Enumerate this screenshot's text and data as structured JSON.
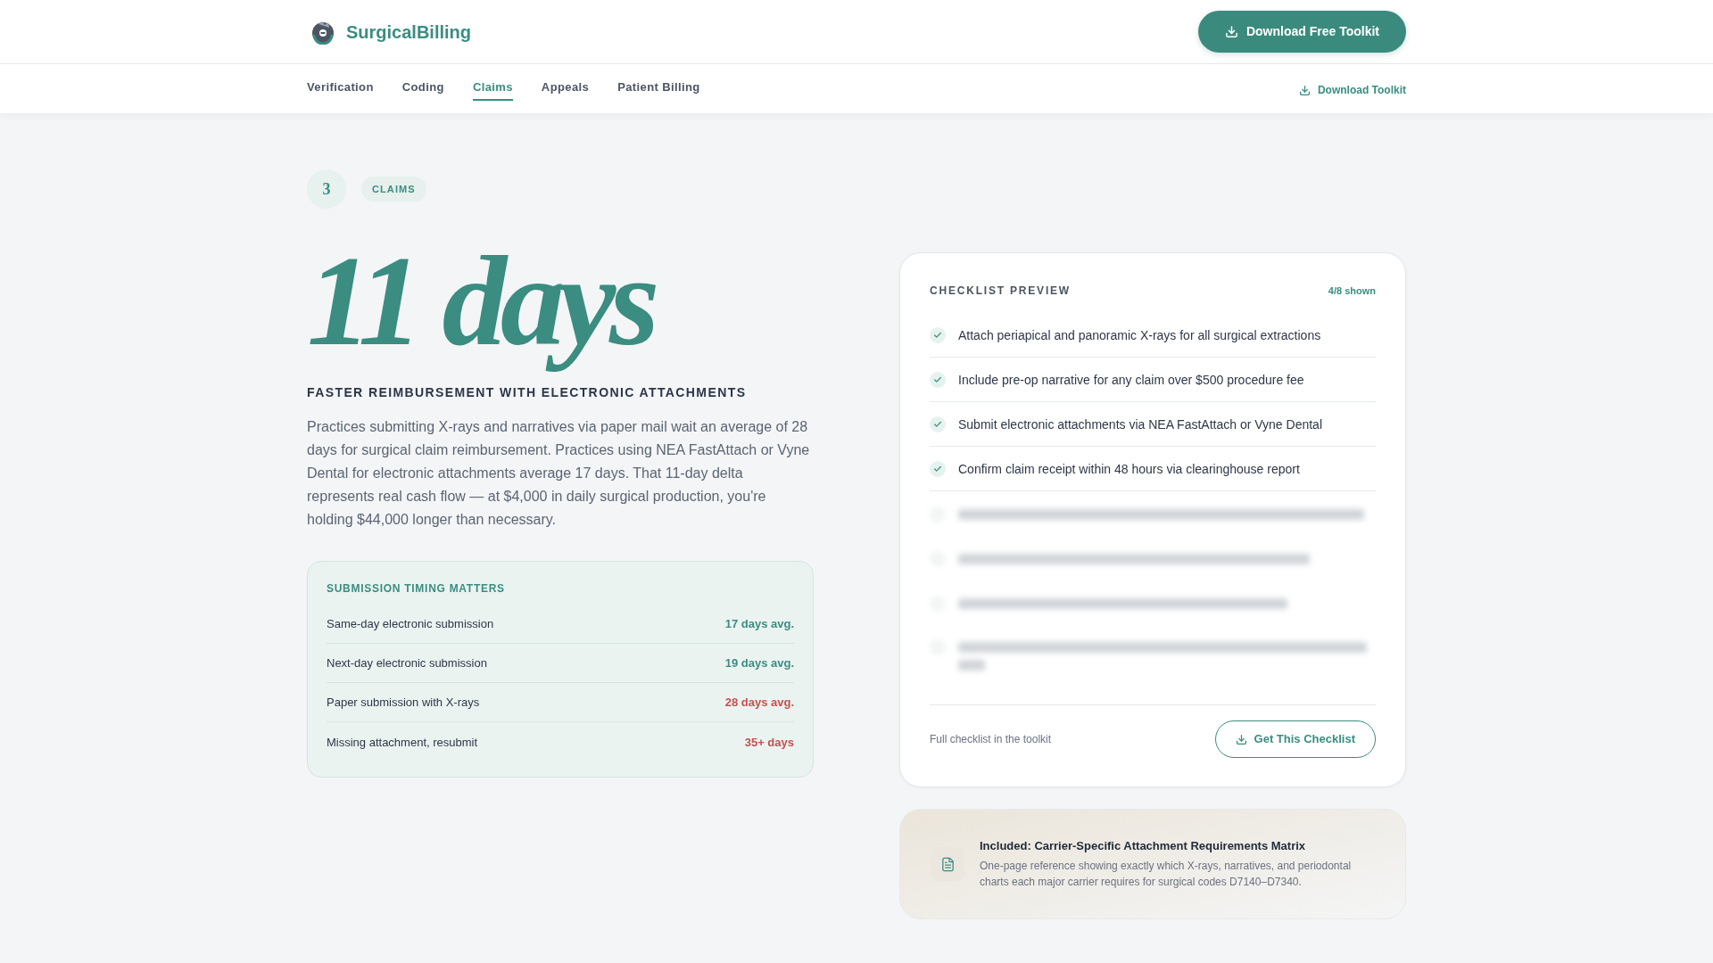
{
  "header": {
    "brand": "SurgicalBilling",
    "cta": "Download Free Toolkit"
  },
  "nav": {
    "items": [
      {
        "label": "Verification",
        "selected": false
      },
      {
        "label": "Coding",
        "selected": false
      },
      {
        "label": "Claims",
        "selected": true
      },
      {
        "label": "Appeals",
        "selected": false
      },
      {
        "label": "Patient Billing",
        "selected": false
      }
    ],
    "download": "Download Toolkit"
  },
  "section": {
    "number": "3",
    "tag": "CLAIMS"
  },
  "hero": {
    "stat": "11 days",
    "subtitle": "FASTER REIMBURSEMENT WITH ELECTRONIC ATTACHMENTS",
    "body": "Practices submitting X-rays and narratives via paper mail wait an average of 28 days for surgical claim reimbursement. Practices using NEA FastAttach or Vyne Dental for electronic attachments average 17 days. That 11-day delta represents real cash flow — at $4,000 in daily surgical production, you're holding $44,000 longer than necessary."
  },
  "timing_table": {
    "title": "SUBMISSION TIMING MATTERS",
    "rows": [
      {
        "label": "Same-day electronic submission",
        "value": "17 days avg.",
        "color": "#3a8d80"
      },
      {
        "label": "Next-day electronic submission",
        "value": "19 days avg.",
        "color": "#3a8d80"
      },
      {
        "label": "Paper submission with X-rays",
        "value": "28 days avg.",
        "color": "#c94f4f"
      },
      {
        "label": "Missing attachment, resubmit",
        "value": "35+ days",
        "color": "#c94f4f"
      }
    ]
  },
  "checklist": {
    "title": "CHECKLIST PREVIEW",
    "count": "4/8 shown",
    "items": [
      {
        "kind": "visible",
        "text": "Attach periapical and panoramic X-rays for all surgical extractions",
        "checked": true
      },
      {
        "kind": "visible",
        "text": "Include pre-op narrative for any claim over $500 procedure fee",
        "checked": true
      },
      {
        "kind": "visible",
        "text": "Submit electronic attachments via NEA FastAttach or Vyne Dental",
        "checked": true
      },
      {
        "kind": "visible",
        "text": "Confirm claim receipt within 48 hours via clearinghouse report",
        "checked": true
      },
      {
        "kind": "blurred",
        "wraps": false
      },
      {
        "kind": "blurred",
        "wraps": false
      },
      {
        "kind": "blurred",
        "wraps": false
      },
      {
        "kind": "blurred",
        "wraps": true
      }
    ],
    "footer_note": "Full checklist in the toolkit",
    "button": "Get This Checklist"
  },
  "included": {
    "title": "Included: Carrier-Specific Attachment Requirements Matrix",
    "description": "One-page reference showing exactly which X-rays, narratives, and periodontal charts each major carrier requires for surgical codes D7140–D7340."
  }
}
